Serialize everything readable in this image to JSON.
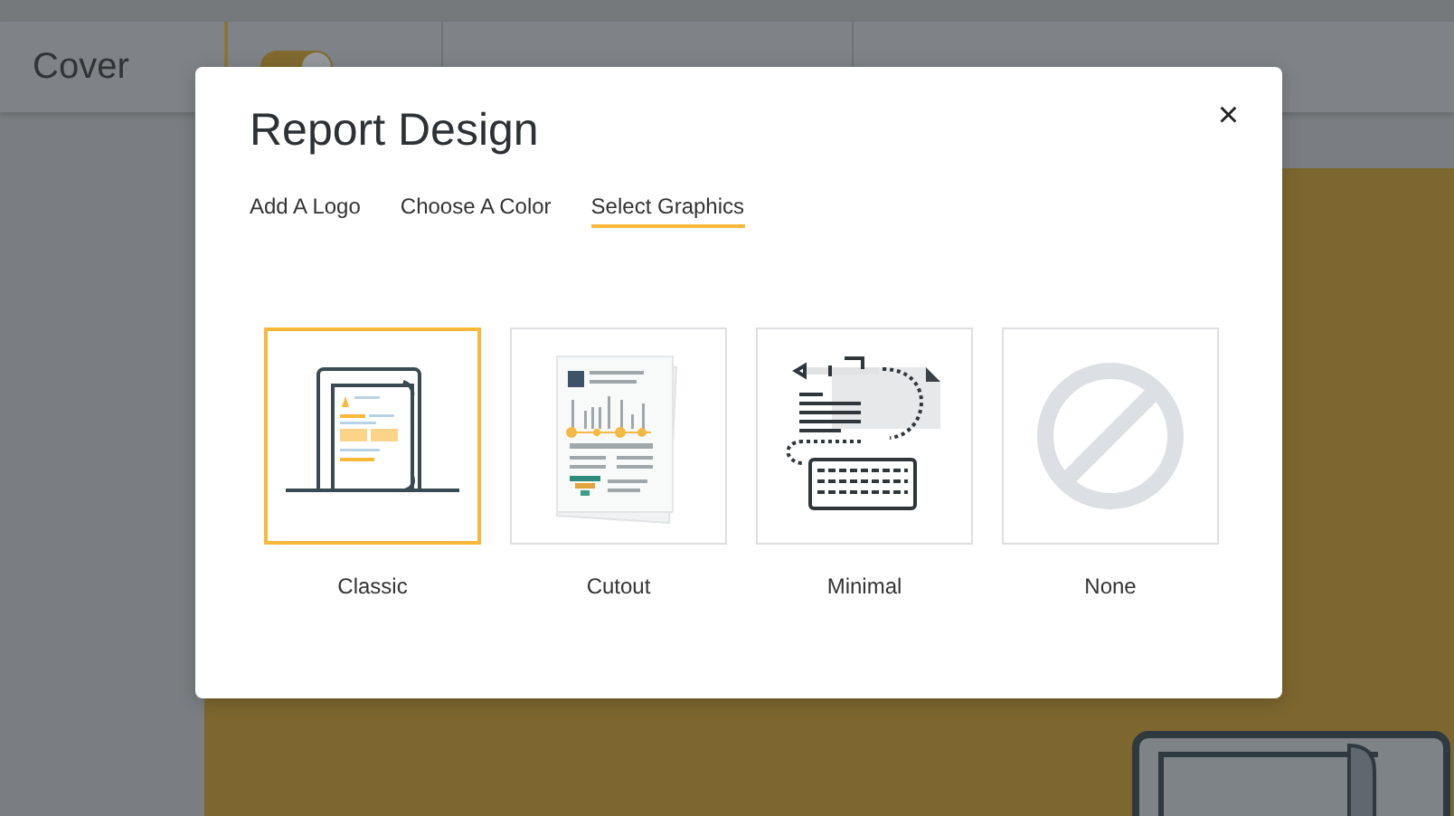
{
  "header": {
    "title": "Cover",
    "toggle": {
      "on": true
    }
  },
  "modal": {
    "title": "Report Design",
    "close": "×",
    "tabs": [
      {
        "label": "Add A Logo",
        "selected": false
      },
      {
        "label": "Choose A Color",
        "selected": false
      },
      {
        "label": "Select Graphics",
        "selected": true
      }
    ],
    "options": [
      {
        "kind": "classic",
        "label": "Classic",
        "selected": true
      },
      {
        "kind": "cutout",
        "label": "Cutout",
        "selected": false
      },
      {
        "kind": "minimal",
        "label": "Minimal",
        "selected": false
      },
      {
        "kind": "none",
        "label": "None",
        "selected": false
      }
    ]
  }
}
